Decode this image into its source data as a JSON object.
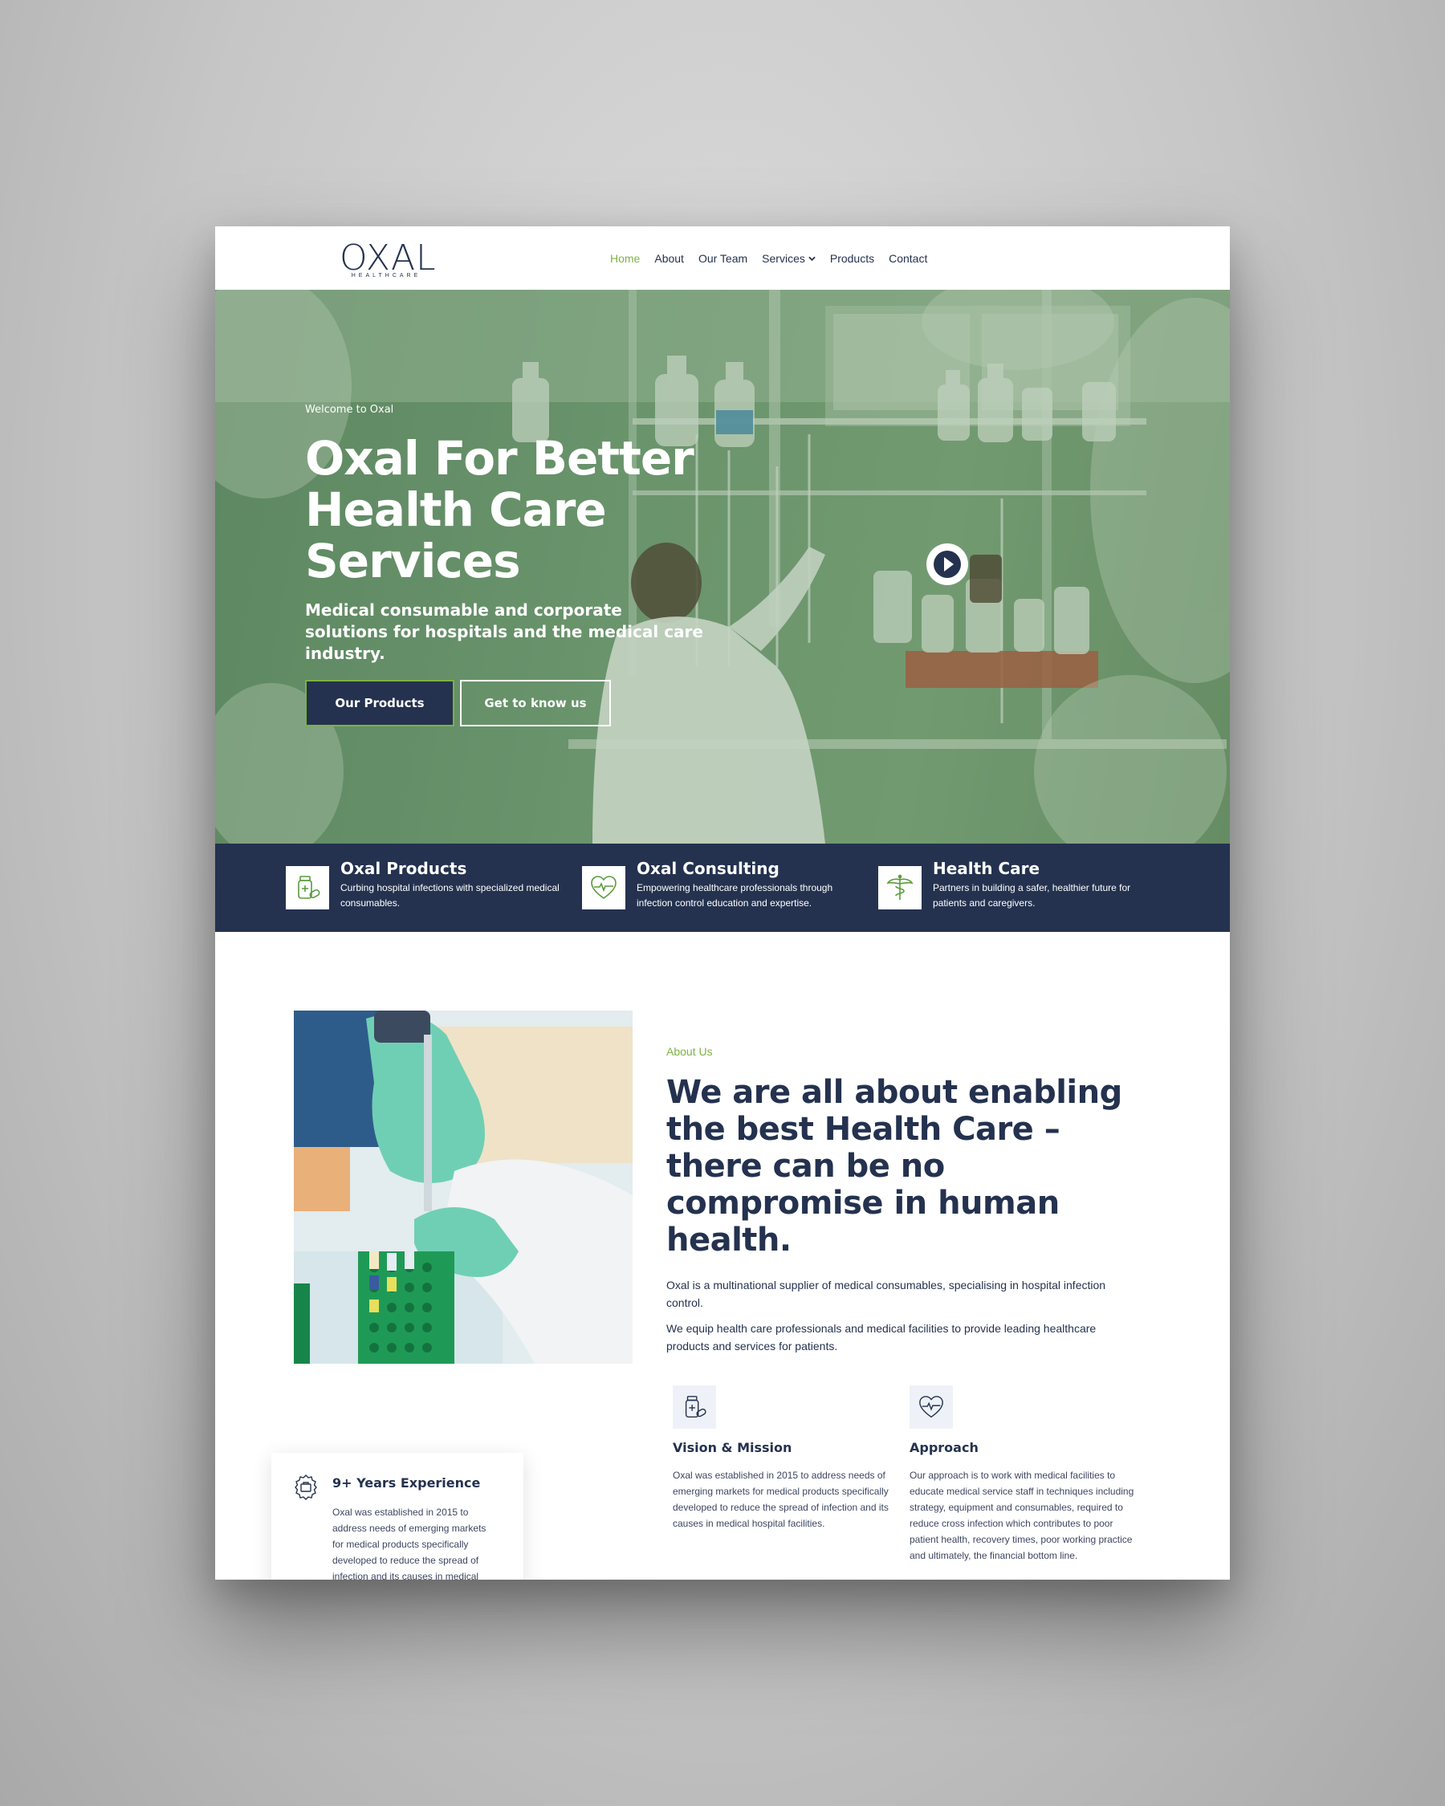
{
  "nav": {
    "logo_text": "OXAL",
    "logo_subtext": "HEALTHCARE",
    "items": [
      {
        "label": "Home",
        "active": true
      },
      {
        "label": "About"
      },
      {
        "label": "Our Team"
      },
      {
        "label": "Services",
        "has_dropdown": true
      },
      {
        "label": "Products"
      },
      {
        "label": "Contact"
      }
    ]
  },
  "hero": {
    "eyebrow": "Welcome to Oxal",
    "title": "Oxal For Better Health Care Services",
    "description": "Medical consumable and corporate solutions for hospitals and the medical care industry.",
    "primary_button": "Our Products",
    "secondary_button": "Get to know us",
    "play_icon": "play-icon"
  },
  "features": [
    {
      "title": "Oxal Products",
      "text": "Curbing hospital infections with specialized medical consumables.",
      "icon": "medicine-bottle-icon"
    },
    {
      "title": "Oxal Consulting",
      "text": "Empowering healthcare professionals through infection control education and expertise.",
      "icon": "heart-pulse-icon"
    },
    {
      "title": "Health Care",
      "text": "Partners in building a safer, healthier future for patients and caregivers.",
      "icon": "caduceus-icon"
    }
  ],
  "about": {
    "label": "About Us",
    "title": "We are all about enabling the best Health Care – there can be no compromise in human health.",
    "paragraph_1": "Oxal is a multinational supplier of medical consumables, specialising in hospital infection control.",
    "paragraph_2": "We equip health care professionals and medical facilities to provide leading healthcare products and services for patients.",
    "cards": [
      {
        "title": "Vision & Mission",
        "text": "Oxal was established in 2015 to address needs of emerging markets for medical products specifically developed to reduce the spread of infection and its causes in medical hospital facilities.",
        "icon": "medicine-bottle-icon"
      },
      {
        "title": "Approach",
        "text": "Our approach is to work with medical facilities to educate medical service staff in techniques including strategy, equipment and consumables, required to reduce cross infection which contributes to poor patient health, recovery times, poor working practice and ultimately, the financial bottom line.",
        "icon": "heart-pulse-icon"
      }
    ]
  },
  "experience": {
    "title": "9+ Years Experience",
    "text": "Oxal was established in 2015 to address needs of emerging markets for medical products specifically developed to reduce the spread of infection and its causes in medical",
    "icon": "award-badge-icon"
  },
  "colors": {
    "navy": "#24324f",
    "accent_green": "#7cb342",
    "hero_tint": "#6f9a72"
  }
}
